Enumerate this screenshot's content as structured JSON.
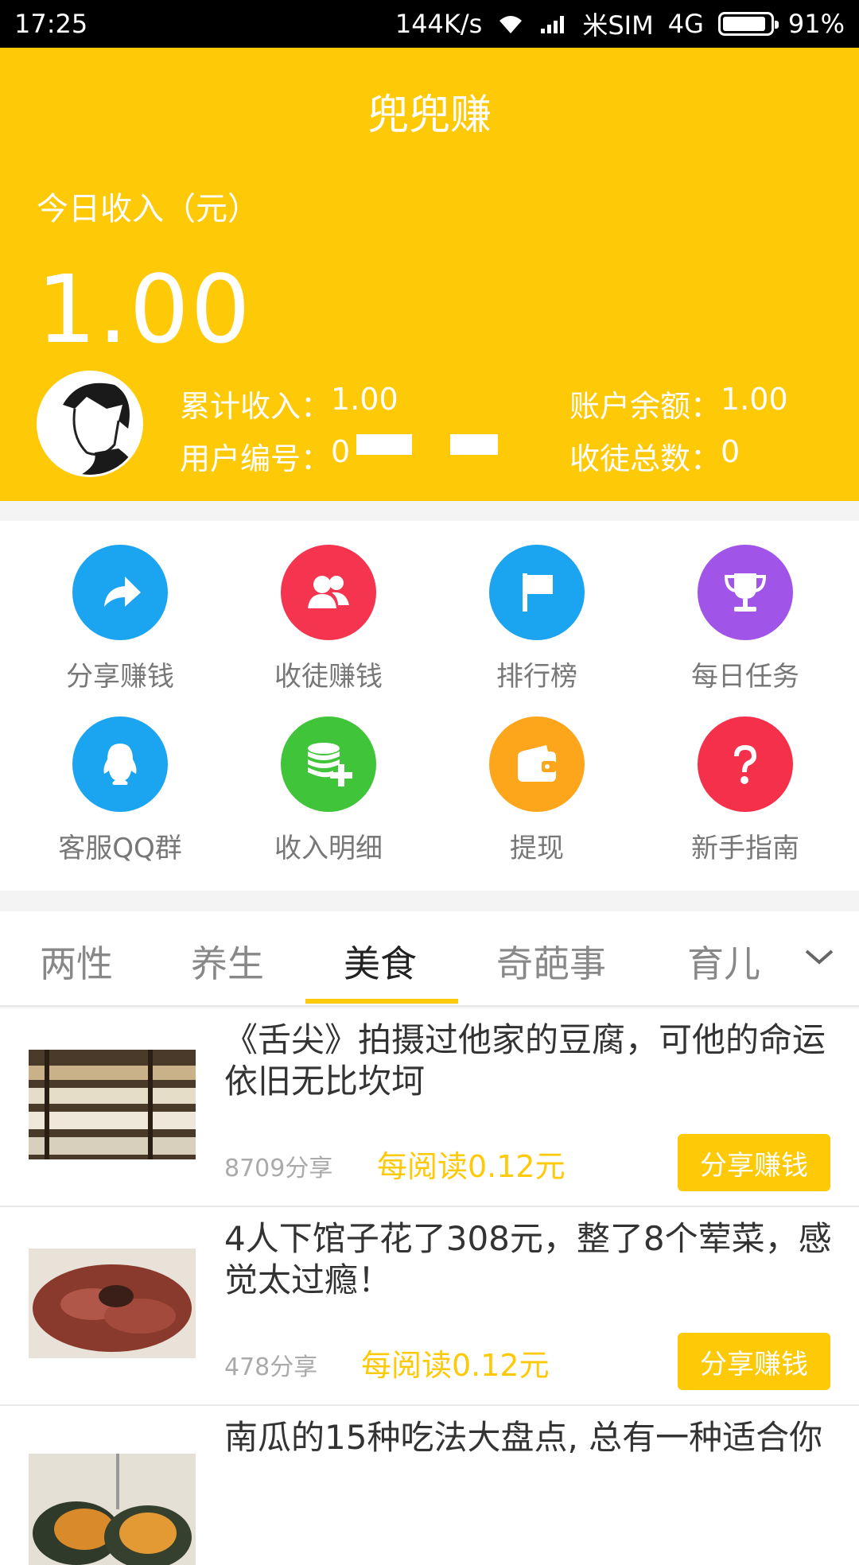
{
  "status_bar": {
    "time": "17:25",
    "speed": "144K/s",
    "carrier": "米SIM",
    "network": "4G",
    "battery": "91%",
    "battery_level": 0.91
  },
  "header": {
    "app_title": "兜兜赚",
    "today_label": "今日收入（元）",
    "today_value": "1.00",
    "total_income_label": "累计收入：",
    "total_income_value": "1.00",
    "balance_label": "账户余额：",
    "balance_value": "1.00",
    "user_id_label": "用户编号：",
    "user_id_value": "0",
    "apprentice_label": "收徒总数：",
    "apprentice_value": "0"
  },
  "grid": [
    {
      "label": "分享赚钱",
      "icon": "share-icon",
      "color": "#1ba4f0"
    },
    {
      "label": "收徒赚钱",
      "icon": "users-icon",
      "color": "#f5354f"
    },
    {
      "label": "排行榜",
      "icon": "flag-icon",
      "color": "#1ba4f0"
    },
    {
      "label": "每日任务",
      "icon": "trophy-icon",
      "color": "#a155e8"
    },
    {
      "label": "客服QQ群",
      "icon": "qq-icon",
      "color": "#1ba4f0"
    },
    {
      "label": "收入明细",
      "icon": "coins-plus-icon",
      "color": "#3fc43a"
    },
    {
      "label": "提现",
      "icon": "wallet-icon",
      "color": "#fda61c"
    },
    {
      "label": "新手指南",
      "icon": "question-icon",
      "color": "#f5304a"
    }
  ],
  "tabs": [
    "两性",
    "养生",
    "美食",
    "奇葩事",
    "育儿"
  ],
  "active_tab": "美食",
  "articles": [
    {
      "title": "《舌尖》拍摄过他家的豆腐，可他的命运依旧无比坎坷",
      "shares": "8709分享",
      "reward": "每阅读0.12元",
      "button": "分享赚钱"
    },
    {
      "title": "4人下馆子花了308元，整了8个荤菜，感觉太过瘾！",
      "shares": "478分享",
      "reward": "每阅读0.12元",
      "button": "分享赚钱"
    },
    {
      "title": "南瓜的15种吃法大盘点, 总有一种适合你",
      "shares": "",
      "reward": "",
      "button": ""
    }
  ],
  "colors": {
    "accent": "#fec906",
    "text": "#333333",
    "muted": "#888888"
  }
}
